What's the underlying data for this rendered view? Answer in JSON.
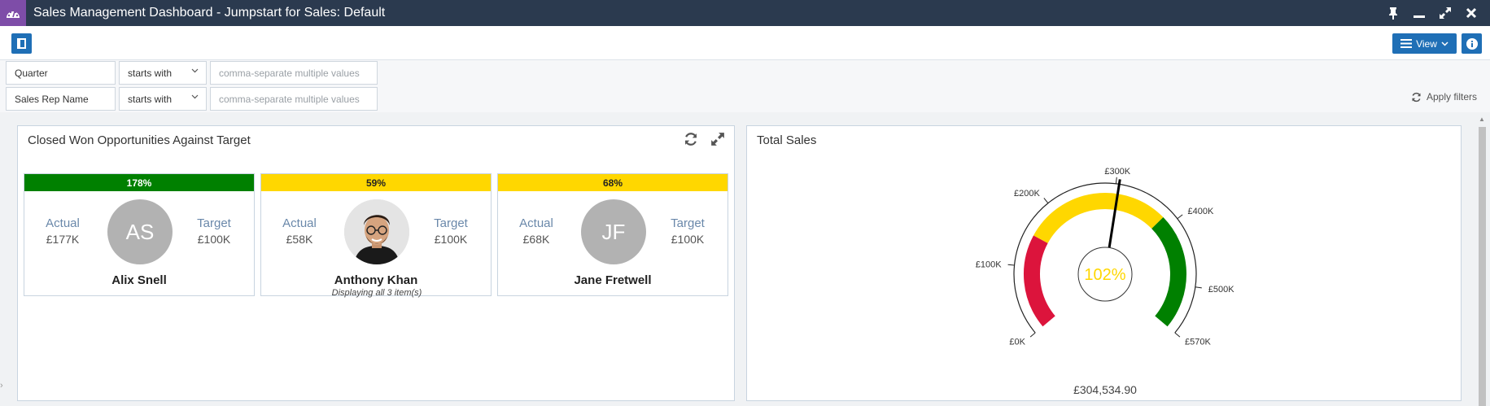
{
  "window": {
    "title": "Sales Management Dashboard - Jumpstart for Sales: Default",
    "app_icon": "dashboard-icon",
    "controls": [
      "pin-icon",
      "minimize-icon",
      "restore-icon",
      "close-icon"
    ]
  },
  "toolbar": {
    "view_label": "View",
    "panel_toggle_icon": "panel-toggle-icon",
    "info_icon": "info-icon"
  },
  "filters": {
    "rows": [
      {
        "field": "Quarter",
        "operator": "starts with",
        "placeholder": "comma-separate multiple values"
      },
      {
        "field": "Sales Rep Name",
        "operator": "starts with",
        "placeholder": "comma-separate multiple values"
      }
    ],
    "apply_label": "Apply filters"
  },
  "closed_won": {
    "title": "Closed Won Opportunities Against Target",
    "footer": "Displaying all 3 item(s)",
    "reps": [
      {
        "percent": "178%",
        "status_color": "#008000",
        "text_color": "#ffffff",
        "actual_label": "Actual",
        "actual": "£177K",
        "target_label": "Target",
        "target": "£100K",
        "initials": "AS",
        "name": "Alix Snell"
      },
      {
        "percent": "59%",
        "status_color": "#ffd700",
        "text_color": "#222222",
        "actual_label": "Actual",
        "actual": "£58K",
        "target_label": "Target",
        "target": "£100K",
        "initials": "",
        "name": "Anthony Khan"
      },
      {
        "percent": "68%",
        "status_color": "#ffd700",
        "text_color": "#222222",
        "actual_label": "Actual",
        "actual": "£68K",
        "target_label": "Target",
        "target": "£100K",
        "initials": "JF",
        "name": "Jane Fretwell"
      }
    ]
  },
  "total_sales": {
    "title": "Total Sales",
    "percent": "102%",
    "total": "£304,534.90",
    "min": 0,
    "max": 570,
    "value": 304.53,
    "ticks": [
      {
        "value": 0,
        "label": "£0K"
      },
      {
        "value": 100,
        "label": "£100K"
      },
      {
        "value": 200,
        "label": "£200K"
      },
      {
        "value": 300,
        "label": "£300K"
      },
      {
        "value": 400,
        "label": "£400K"
      },
      {
        "value": 500,
        "label": "£500K"
      },
      {
        "value": 570,
        "label": "£570K"
      }
    ],
    "bands": [
      {
        "from": 0,
        "to": 150,
        "color": "#dc143c"
      },
      {
        "from": 150,
        "to": 385,
        "color": "#ffd700"
      },
      {
        "from": 385,
        "to": 570,
        "color": "#008000"
      }
    ],
    "percent_color": "#ffd700"
  }
}
